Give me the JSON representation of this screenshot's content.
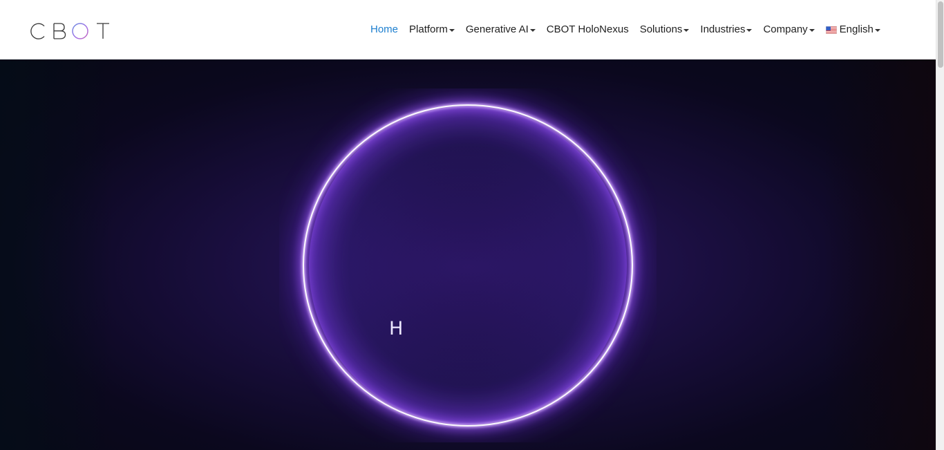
{
  "logo": {
    "text": "CBOT"
  },
  "nav": {
    "items": [
      {
        "label": "Home",
        "active": true,
        "dropdown": false
      },
      {
        "label": "Platform",
        "active": false,
        "dropdown": true
      },
      {
        "label": "Generative AI",
        "active": false,
        "dropdown": true
      },
      {
        "label": "CBOT HoloNexus",
        "active": false,
        "dropdown": false
      },
      {
        "label": "Solutions",
        "active": false,
        "dropdown": true
      },
      {
        "label": "Industries",
        "active": false,
        "dropdown": true
      },
      {
        "label": "Company",
        "active": false,
        "dropdown": true
      }
    ],
    "language": {
      "label": "English",
      "flag_icon": "us-flag-icon"
    }
  },
  "hero": {
    "letter": "H",
    "ring_icon": "glow-ring-icon"
  },
  "colors": {
    "active_link": "#1d7fcf",
    "text": "#1f1f1f",
    "hero_bg": "#14093a",
    "ring": "#b07cff"
  }
}
